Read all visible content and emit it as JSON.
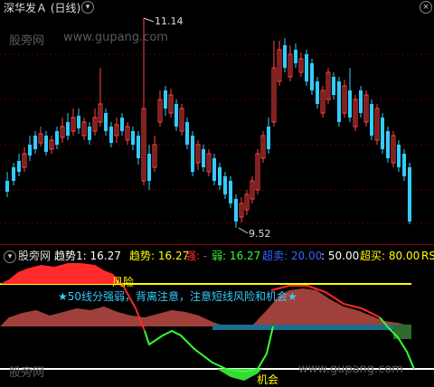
{
  "top_panel": {
    "title": "深华发Ａ (日线)",
    "high_label": "11.14",
    "low_label": "9.52",
    "watermark_cn": "股旁网",
    "watermark_url": "www.gupang.com",
    "colors": {
      "up": "#ff4444",
      "down": "#33ccff",
      "bg": "#000000",
      "grid": "#8b0000"
    }
  },
  "bottom_panel": {
    "watermark_cn": "股旁网",
    "watermark_url": "www.gupang.com",
    "legend": [
      {
        "label": "趋势1: 16.27",
        "color": "#ffffff"
      },
      {
        "label": "趋势: 16.27",
        "color": "#ffff00"
      },
      {
        "label": "强: -",
        "color": "#ff3333"
      },
      {
        "label": "弱: 16.27",
        "color": "#33ff33"
      },
      {
        "label": "超卖: 20.00",
        "color": "#3366ff"
      },
      {
        "label": ": 50.00",
        "color": "#ffffff"
      },
      {
        "label": "超买: 80.00",
        "color": "#ffff00"
      },
      {
        "label": "RS",
        "color": "#ffff00"
      }
    ],
    "annotation_risk": "风险",
    "annotation_note": "★50线分强弱，背离注意，注意短线风险和机会★",
    "annotation_chance": "机会",
    "colors": {
      "strong": "#ff2a2a",
      "weak": "#33dd33",
      "mid_fill": "#a0403a",
      "overbought_line": "#ffff00",
      "oversold_line": "#ffffff",
      "neutral": "#1c6e8c"
    }
  }
}
